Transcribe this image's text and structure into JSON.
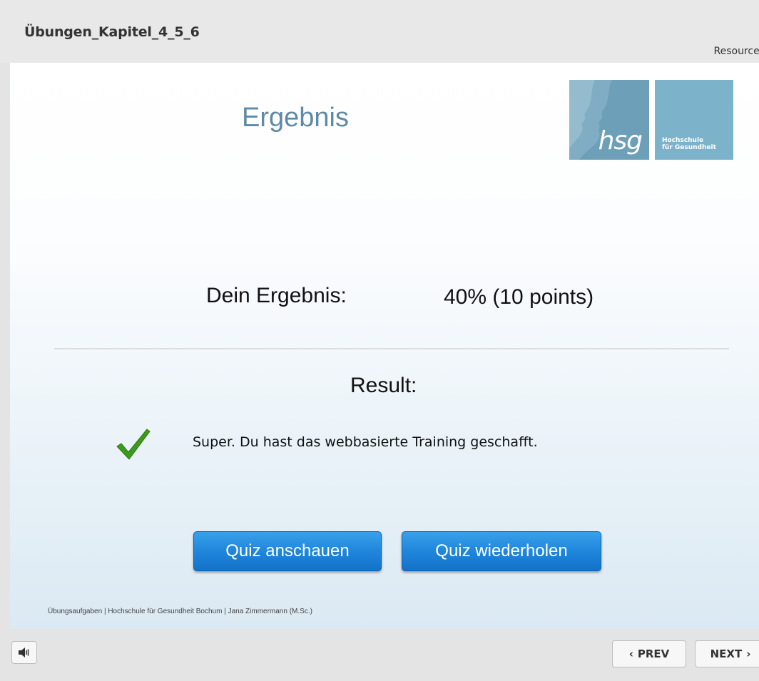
{
  "header": {
    "course_title": "Übungen_Kapitel_4_5_6",
    "resources_label": "Resources"
  },
  "slide": {
    "title": "Ergebnis",
    "logo": {
      "short": "hsg",
      "name_line1": "Hochschule",
      "name_line2": "für Gesundheit"
    },
    "score_label": "Dein Ergebnis:",
    "score_value": "40% (10 points)",
    "result_label": "Result:",
    "result_message": "Super. Du hast das webbasierte Training geschafft.",
    "buttons": {
      "review_label": "Quiz anschauen",
      "retry_label": "Quiz wiederholen"
    },
    "footer": "Übungsaufgaben | Hochschule für Gesundheit Bochum | Jana Zimmermann (M.Sc.)"
  },
  "player": {
    "audio_icon": "speaker-icon",
    "prev_label": "PREV",
    "next_label": "NEXT"
  },
  "colors": {
    "title_blue": "#5e8aa5",
    "button_blue": "#1f86dc",
    "check_green": "#3c9a1c",
    "logo_dark": "#6e9fb8",
    "logo_light": "#7db2cb"
  }
}
